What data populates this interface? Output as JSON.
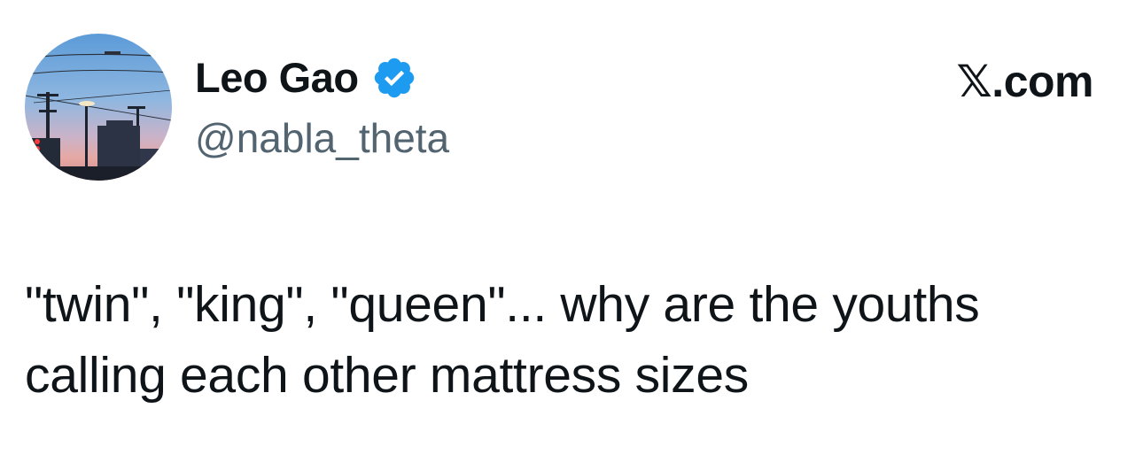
{
  "tweet": {
    "author": {
      "display_name": "Leo Gao",
      "handle": "@nabla_theta",
      "verified": true,
      "avatar_icon": "profile-photo-sunset-power-lines"
    },
    "source_logo": "𝕏.com",
    "text_lines": [
      "\"twin\", \"king\", \"queen\"... why are the youths",
      "calling each other mattress sizes"
    ]
  },
  "colors": {
    "text_primary": "#0f1419",
    "text_secondary": "#536471",
    "verified_blue": "#1d9bf0",
    "background": "#ffffff"
  }
}
